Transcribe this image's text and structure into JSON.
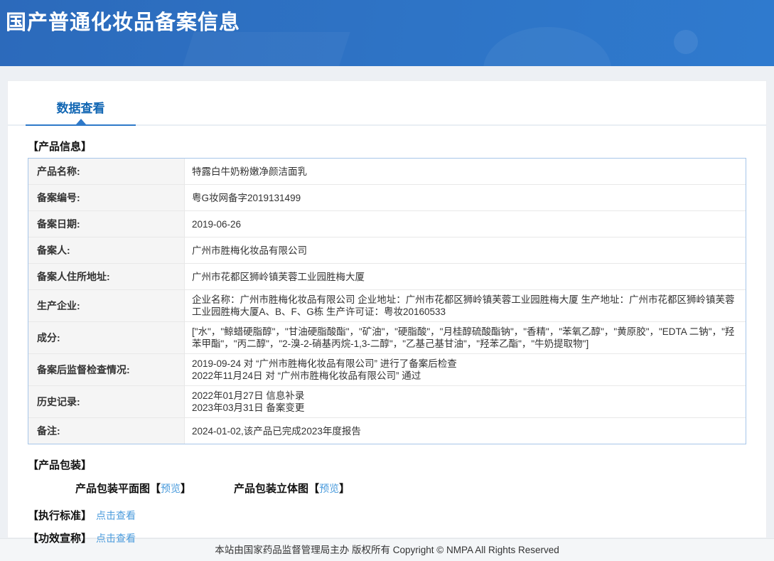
{
  "header": {
    "title": "国产普通化妆品备案信息"
  },
  "tabs": {
    "data_view": "数据查看"
  },
  "product_info": {
    "section_title": "【产品信息】",
    "rows": [
      {
        "label": "产品名称:",
        "value": "特露白牛奶粉嫩净颜洁面乳"
      },
      {
        "label": "备案编号:",
        "value": "粤G妆网备字2019131499"
      },
      {
        "label": "备案日期:",
        "value": "2019-06-26"
      },
      {
        "label": "备案人:",
        "value": "广州市胜梅化妆品有限公司"
      },
      {
        "label": "备案人住所地址:",
        "value": "广州市花都区狮岭镇芙蓉工业园胜梅大厦"
      },
      {
        "label": "生产企业:",
        "value": "企业名称：广州市胜梅化妆品有限公司 企业地址：广州市花都区狮岭镇芙蓉工业园胜梅大厦 生产地址：广州市花都区狮岭镇芙蓉工业园胜梅大厦A、B、F、G栋 生产许可证：粤妆20160533"
      },
      {
        "label": "成分:",
        "value": "[\"水\"，\"鲸蜡硬脂醇\"，\"甘油硬脂酸酯\"，\"矿油\"，\"硬脂酸\"，\"月桂醇硫酸酯钠\"，\"香精\"，\"苯氧乙醇\"，\"黄原胶\"，\"EDTA 二钠\"，\"羟苯甲酯\"，\"丙二醇\"，\"2-溴-2-硝基丙烷-1,3-二醇\"，\"乙基己基甘油\"，\"羟苯乙酯\"，\"牛奶提取物\"]"
      },
      {
        "label": "备案后监督检查情况:",
        "value": "2019-09-24 对 “广州市胜梅化妆品有限公司” 进行了备案后检查\n2022年11月24日 对 “广州市胜梅化妆品有限公司” 通过"
      },
      {
        "label": "历史记录:",
        "value": "2022年01月27日 信息补录\n2023年03月31日 备案变更"
      },
      {
        "label": "备注:",
        "value": "2024-01-02,该产品已完成2023年度报告"
      }
    ]
  },
  "packaging": {
    "section_title": "【产品包装】",
    "bracket_open": "【",
    "bracket_close": "】",
    "items": [
      {
        "label": "产品包装平面图",
        "link": "预览"
      },
      {
        "label": "产品包装立体图 ",
        "link": "预览"
      }
    ]
  },
  "standard": {
    "section_title": "【执行标准】",
    "link": "点击查看"
  },
  "efficacy": {
    "section_title": "【功效宣称】",
    "link": "点击查看"
  },
  "footer": {
    "text": "本站由国家药品监督管理局主办 版权所有 Copyright © NMPA All Rights Reserved"
  },
  "colors": {
    "header_blue_start": "#2c6abb",
    "header_blue_end": "#2f7ace",
    "tab_accent": "#2e79c9",
    "tab_text": "#1166b3",
    "link_blue": "#4a9bdc",
    "table_border": "#a7c6e9",
    "label_bg": "#f5f5f5"
  }
}
